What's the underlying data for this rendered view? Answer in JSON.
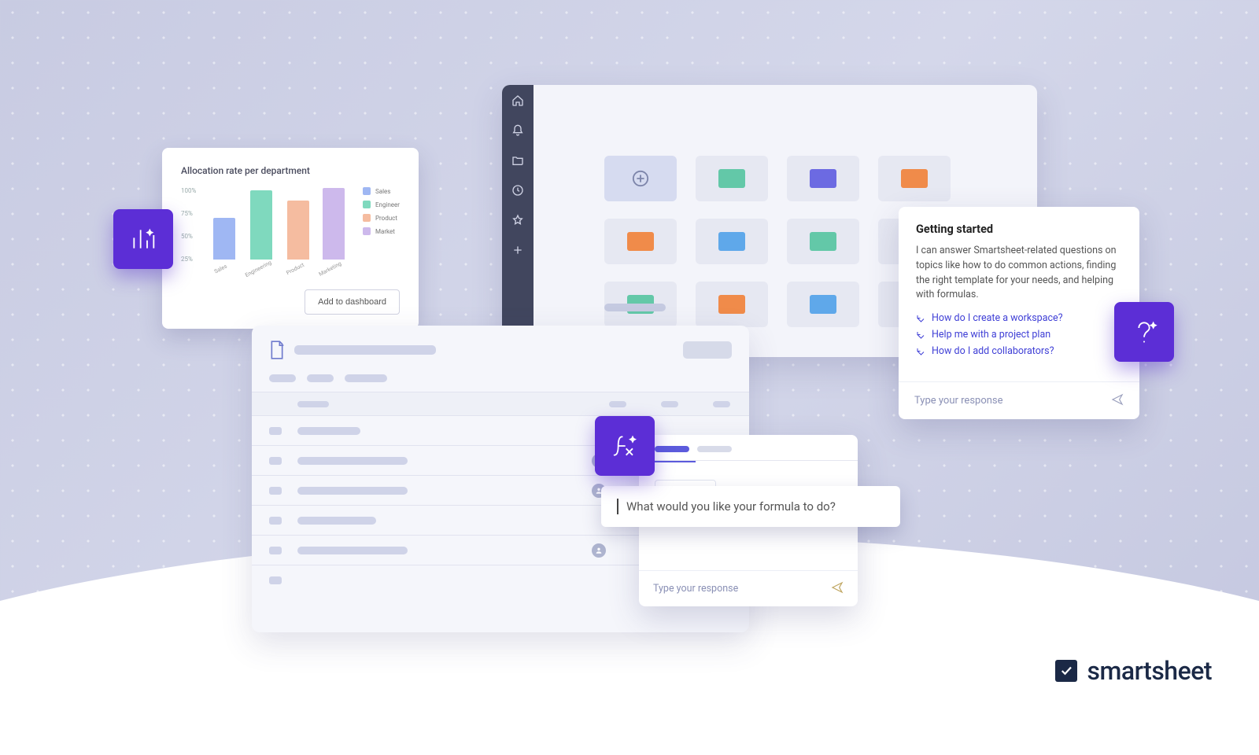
{
  "brand": {
    "name": "smartsheet"
  },
  "chart_card": {
    "title": "Allocation rate per department",
    "button": "Add to dashboard"
  },
  "chart_data": {
    "type": "bar",
    "title": "Allocation rate per department",
    "ylabel": "",
    "xlabel": "",
    "ylim": [
      0,
      100
    ],
    "y_ticks": [
      "100%",
      "75%",
      "50%",
      "25%"
    ],
    "categories": [
      "Sales",
      "Engineering",
      "Product",
      "Marketing"
    ],
    "series": [
      {
        "name": "Sales",
        "color": "#9fb7f3",
        "value": 55
      },
      {
        "name": "Engineering",
        "color": "#7fd9be",
        "value": 92
      },
      {
        "name": "Product",
        "color": "#f5bca0",
        "value": 78
      },
      {
        "name": "Marketing",
        "color": "#cdb9ec",
        "value": 95
      }
    ],
    "legend": [
      "Sales",
      "Engineer",
      "Product",
      "Market"
    ]
  },
  "formula": {
    "prompt_placeholder": "What would you like your formula to do?",
    "input_placeholder": "Type your response"
  },
  "help": {
    "title": "Getting started",
    "body": "I can answer Smartsheet-related questions on topics like how to do common actions, finding the right template for your needs, and helping with formulas.",
    "links": [
      "How do I create a workspace?",
      "Help me with a project plan",
      "How do I add collaborators?"
    ],
    "input_placeholder": "Type your response"
  }
}
